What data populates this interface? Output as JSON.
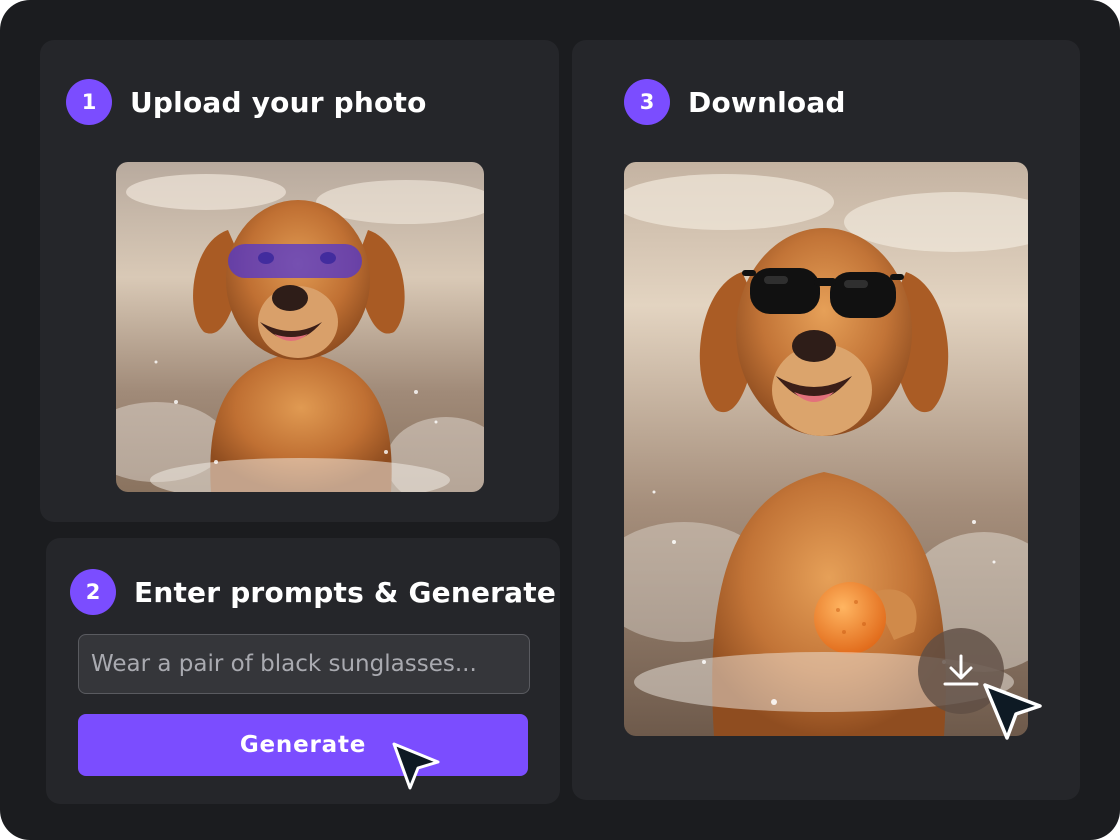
{
  "steps": {
    "upload": {
      "number": "1",
      "title": "Upload your photo"
    },
    "prompt": {
      "number": "2",
      "title": "Enter prompts & Generate"
    },
    "download": {
      "number": "3",
      "title": "Download"
    }
  },
  "prompt_input": {
    "placeholder": "Wear a pair of black sunglasses..."
  },
  "generate_button": {
    "label": "Generate"
  },
  "icons": {
    "download": "download-icon",
    "cursor": "mouse-pointer-icon"
  },
  "colors": {
    "background": "#1b1c1f",
    "panel": "#25262a",
    "accent": "#7b4dff",
    "input_bg": "#35363a"
  }
}
